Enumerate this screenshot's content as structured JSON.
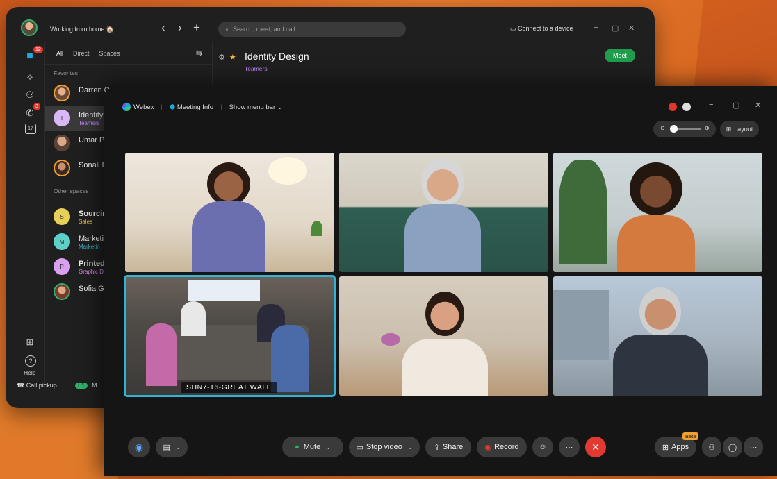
{
  "app": {
    "status": "Working from home 🏠",
    "search_placeholder": "Search, meet, and call",
    "connect_label": "Connect to a device",
    "rail_badges": {
      "messages": "12",
      "calls": "3"
    },
    "calendar_day": "17",
    "help_label": "Help",
    "filters": [
      "All",
      "Direct",
      "Spaces"
    ],
    "favorites_header": "Favorites",
    "other_header": "Other spaces",
    "favorites": [
      {
        "name": "Darren O",
        "initial": "",
        "sub": ""
      },
      {
        "name": "Identity",
        "initial": "I",
        "sub": "Teamers"
      },
      {
        "name": "Umar P",
        "initial": "",
        "sub": ""
      },
      {
        "name": "Sonali F",
        "initial": "",
        "sub": ""
      }
    ],
    "spaces": [
      {
        "name": "Sourcir",
        "initial": "S",
        "sub": "Sales",
        "color": "#e8cf5a",
        "subcolor": "#e8c84a"
      },
      {
        "name": "Marketi",
        "initial": "M",
        "sub": "Marketin",
        "color": "#5fd0c8",
        "subcolor": "#3fb0c8"
      },
      {
        "name": "Printed",
        "initial": "P",
        "sub": "Graphic D",
        "color": "#d9a0f0",
        "subcolor": "#e08cf0"
      },
      {
        "name": "Sofia Gc",
        "initial": "",
        "sub": ""
      }
    ],
    "footer_call_pickup": "Call pickup",
    "footer_line": "L1",
    "footer_extra": "M",
    "chat_title": "Identity Design",
    "chat_sub": "Teamers",
    "meet_label": "Meet"
  },
  "meeting": {
    "brand": "Webex",
    "info": "Meeting Info",
    "menu": "Show menu bar",
    "layout_label": "Layout",
    "room_label": "SHN7-16-GREAT WALL",
    "controls": {
      "mute": "Mute",
      "stop_video": "Stop video",
      "share": "Share",
      "record": "Record",
      "apps": "Apps",
      "beta": "Beta"
    }
  },
  "colors": {
    "accent": "#1f9d4d",
    "end_call": "#e23a33",
    "active_tile": "#2fb3d6"
  }
}
